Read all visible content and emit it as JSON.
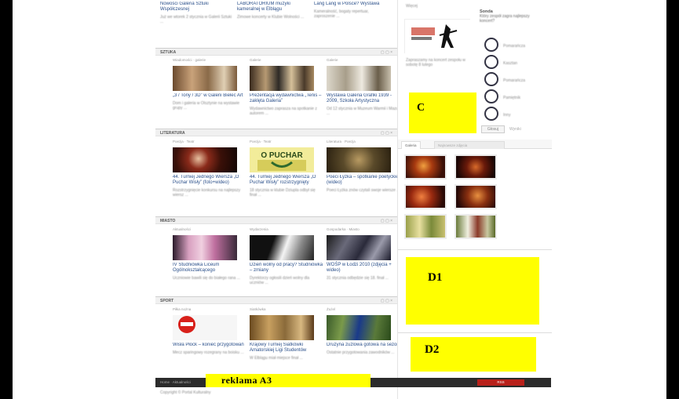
{
  "layout_ads": {
    "c": "C",
    "d1": "D1",
    "d2": "D2",
    "a3": "reklama A3"
  },
  "sections": [
    {
      "title": "SZTUKA",
      "controls": "▢ ▢ ×"
    },
    {
      "title": "LITERATURA",
      "controls": "▢ ▢ ×"
    },
    {
      "title": "MIASTO",
      "controls": "▢ ▢ ×"
    },
    {
      "title": "SPORT",
      "controls": "▢ ▢ ×"
    }
  ],
  "top_articles": [
    {
      "title": "Nowości Galeria Sztuki Współczesnej",
      "desc": "Już we wtorek 2 stycznia w Galerii Sztuki ..."
    },
    {
      "title": "LABORATORIUM muzyki kameralnej w Elblągu",
      "desc": "Zimowe koncerty w Klubie Wolności ..."
    },
    {
      "title": "Lang Lang w Polsce? Wystawa",
      "desc": "Kameralność, bogaty repertuar, zaproszenie ..."
    }
  ],
  "art_articles": [
    {
      "cat": "Wiadomości · galerie",
      "title": "„3 / Tony / 3D” w Galerii Bielec Art",
      "desc": "Dom i galeria w Olsztynie na wystawie grupy ..."
    },
    {
      "cat": "Galerie",
      "title": "Prezentacja wydawnictwa „Tenis – zaklęta Galeria”",
      "desc": "Wydawnictwo zaprasza na spotkanie z autorem ..."
    },
    {
      "cat": "Galerie",
      "title": "Wystawa Galeria Grafiki 1939 - 2009, Szkoła Artystyczna",
      "desc": "Od 12 stycznia w Muzeum Warmii i Mazur ..."
    }
  ],
  "lit_articles": [
    {
      "cat": "Poezja · Teatr",
      "title": "44. Turniej Jednego Wiersza „O Puchar Wisły” (foto+wideo)",
      "desc": "Rozstrzygnięcie konkursu na najlepszy wiersz ..."
    },
    {
      "cat": "Poezja · Teatr",
      "title": "44. Turniej Jednego Wiersza „O Puchar Wisły” rozstrzygnięty",
      "desc": "18 stycznia w klubie Dziupla odbył się finał ..."
    },
    {
      "cat": "Literatura · Poezja",
      "title": "Poeci Łyżka – spotkanie poetyckie (wideo)",
      "desc": "Poeci Łyżka znów czytali swoje wiersze ..."
    }
  ],
  "city_articles": [
    {
      "cat": "Aktualności",
      "title": "IV Studniówka Liceum Ogólnokształcącego",
      "desc": "Uczniowie bawili się do białego rana ..."
    },
    {
      "cat": "Wydarzenia",
      "title": "Dzień wolny od pracy? Studniówka – zmiany",
      "desc": "Dyrektorzy ogłosili dzień wolny dla uczniów ..."
    },
    {
      "cat": "Gospodarka · Miasto",
      "title": "WOŚP w Łodzi 2010 (zdjęcia + wideo)",
      "desc": "31 stycznia odbędzie się 18. finał ..."
    }
  ],
  "sport_articles": [
    {
      "cat": "Piłka nożna",
      "title": "Wisła Płock – koniec przygotowań",
      "desc": "Mecz sparingowy rozegrany na boisku ..."
    },
    {
      "cat": "Siatkówka",
      "title": "Krajowy Turniej Siatkówki Amatorskiej Ligi Studentów",
      "desc": "W Elblągu miał miejsce finał ..."
    },
    {
      "cat": "Żużel",
      "title": "Drużyna żużlowa gotowa na sezon",
      "desc": "Ostatnie przygotowania zawodników ..."
    }
  ],
  "sidebar": {
    "poll_title": "Sonda",
    "poll_question": "Który zespół zagra najlepszy koncert?",
    "poll_options": [
      "Pomarańcza",
      "Kasztan",
      "Pomarańcza",
      "Pamiętnik",
      "Inny"
    ],
    "poll_button": "Głosuj",
    "poll_results": "Wyniki",
    "promo_caption": "Zapraszamy na koncert zespołu w sobotę 8 lutego",
    "tab_active": "Galeria",
    "tab_inactive": "Najnowsze zdjęcia",
    "top_link": "Więcej"
  },
  "footer": {
    "left_links": "Home  ·  Aktualności",
    "right_button": "RSS",
    "bottom_text": "Copyright © Portal Kulturalny"
  }
}
